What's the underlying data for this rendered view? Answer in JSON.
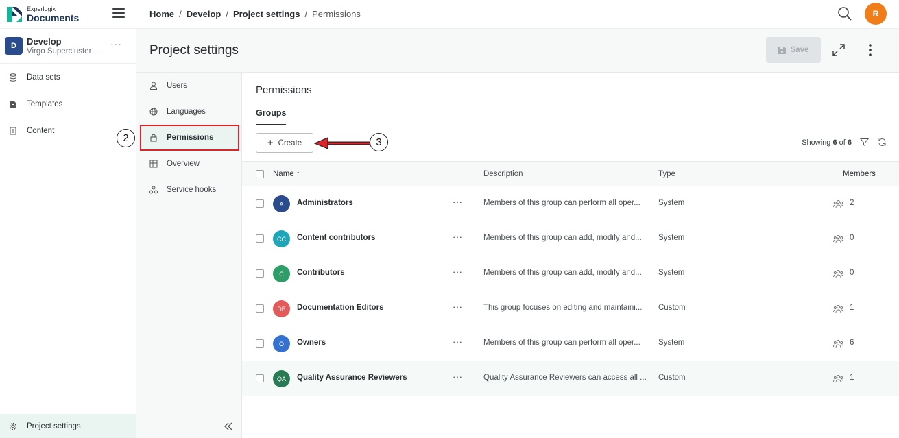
{
  "brand": {
    "small": "Experlogix",
    "big": "Documents"
  },
  "project": {
    "initial": "D",
    "name": "Develop",
    "subtitle": "Virgo Supercluster ...",
    "more": "···"
  },
  "sidebar": {
    "items": [
      {
        "label": "Data sets",
        "icon": "database-icon"
      },
      {
        "label": "Templates",
        "icon": "template-icon"
      },
      {
        "label": "Content",
        "icon": "content-icon"
      }
    ],
    "settings_label": "Project settings"
  },
  "breadcrumb": {
    "items": [
      "Home",
      "Develop",
      "Project settings"
    ],
    "current": "Permissions",
    "sep": "/"
  },
  "user": {
    "initial": "R"
  },
  "header": {
    "title": "Project settings",
    "save_label": "Save"
  },
  "settings_nav": {
    "items": [
      {
        "label": "Users"
      },
      {
        "label": "Languages"
      },
      {
        "label": "Permissions"
      },
      {
        "label": "Overview"
      },
      {
        "label": "Service hooks"
      }
    ]
  },
  "annotations": {
    "two": "2",
    "three": "3"
  },
  "main": {
    "title": "Permissions",
    "tab": "Groups",
    "create_label": "Create",
    "showing_prefix": "Showing",
    "showing_count": "6",
    "showing_of": "of",
    "showing_total": "6",
    "columns": {
      "name": "Name ↑",
      "description": "Description",
      "type": "Type",
      "members": "Members"
    },
    "rows": [
      {
        "initials": "A",
        "color": "#2b4c8c",
        "name": "Administrators",
        "description": "Members of this group can perform all oper...",
        "type": "System",
        "members": "2"
      },
      {
        "initials": "CC",
        "color": "#1fa5b8",
        "name": "Content contributors",
        "description": "Members of this group can add, modify and...",
        "type": "System",
        "members": "0"
      },
      {
        "initials": "C",
        "color": "#2e9e68",
        "name": "Contributors",
        "description": "Members of this group can add, modify and...",
        "type": "System",
        "members": "0"
      },
      {
        "initials": "DE",
        "color": "#e25a5a",
        "name": "Documentation Editors",
        "description": "This group focuses on editing and maintaini...",
        "type": "Custom",
        "members": "1"
      },
      {
        "initials": "O",
        "color": "#3572d0",
        "name": "Owners",
        "description": "Members of this group can perform all oper...",
        "type": "System",
        "members": "6"
      },
      {
        "initials": "QA",
        "color": "#2a7a56",
        "name": "Quality Assurance Reviewers",
        "description": "Quality Assurance Reviewers can access all ...",
        "type": "Custom",
        "members": "1"
      }
    ]
  }
}
